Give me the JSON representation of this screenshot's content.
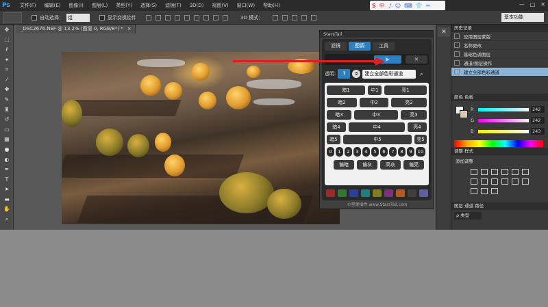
{
  "app": {
    "logo": "Ps"
  },
  "menu": [
    "文件(F)",
    "编辑(E)",
    "图像(I)",
    "图层(L)",
    "类型(Y)",
    "选择(S)",
    "滤镜(T)",
    "3D(D)",
    "视图(V)",
    "窗口(W)",
    "帮助(H)"
  ],
  "window_controls": [
    "—",
    "□",
    "✕"
  ],
  "ime": {
    "logo": "S",
    "items": [
      "中",
      "♪",
      "☺",
      "⌨",
      "👕",
      "👕",
      "✂"
    ]
  },
  "options": {
    "auto_select_label": "自动选择：",
    "auto_select_value": "组",
    "transform_label": "显示变换控件",
    "mode_3d_label": "3D 模式：",
    "workspace": "基本功能"
  },
  "document": {
    "tab_title": "_DSC2676.NEF @ 13.2% (图层 0, RGB/8*) *",
    "close": "×"
  },
  "plugin": {
    "title": "StarsTail",
    "tabs": [
      "滤镜",
      "图调",
      "工具"
    ],
    "play": "▶",
    "close": "×",
    "opacity_label": "透明:",
    "opacity_button": "↑",
    "preset_value": "建立全部色彩通道",
    "rows": [
      [
        "暗1",
        "中1",
        "亮1"
      ],
      [
        "暗2",
        "中2",
        "亮2"
      ],
      [
        "暗3",
        "中3",
        "亮3"
      ],
      [
        "暗4",
        "中4",
        "亮4"
      ],
      [
        "暗5",
        "中5",
        "亮5"
      ]
    ],
    "numbers": [
      "0",
      "1",
      "2",
      "3",
      "4",
      "5",
      "6",
      "7",
      "8",
      "9",
      "10"
    ],
    "bottom_buttons": [
      "偏暗",
      "偏灰",
      "高灰",
      "偏亮"
    ],
    "swatch_colors": [
      "#9b2b2b",
      "#2f7a2f",
      "#2b3f9b",
      "#1f7f7f",
      "#7f7f1f",
      "#7f2f7f",
      "#b55a1f",
      "#3f3f3f",
      "#5f5f9f",
      "#2f8f5f"
    ],
    "footer": "©星尾插件 www.StarsTail.com"
  },
  "history": {
    "title": "历史记录",
    "items": [
      "应用图层蒙版",
      "名称更改",
      "基础色调图层",
      "通道/图层操作",
      "建立全部色彩通道"
    ]
  },
  "color": {
    "tabs": "颜色  色板",
    "channels": [
      {
        "label": "R",
        "value": "242"
      },
      {
        "label": "G",
        "value": "242"
      },
      {
        "label": "B",
        "value": "243"
      }
    ]
  },
  "adjustments": {
    "tabs": "调整  样式",
    "label": "添加调整"
  },
  "layers": {
    "tabs": "图层  通道  路径",
    "kind": "ρ 类型"
  },
  "colors": {
    "accent": "#2c7fc0",
    "arrow": "#e11d1d",
    "history_selected": "#8ab4d8"
  }
}
